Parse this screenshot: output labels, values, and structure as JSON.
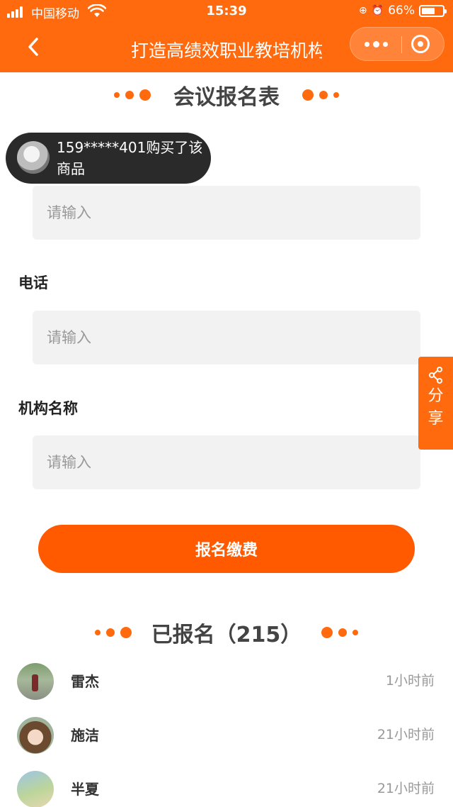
{
  "status_bar": {
    "carrier": "中国移动",
    "time": "15:39",
    "battery_text": "66%",
    "battery_level": 0.66
  },
  "nav": {
    "title": "打造高绩效职业教培机构",
    "back_icon": "chevron-left-icon",
    "more_icon": "more-dots-icon",
    "close_icon": "target-close-icon"
  },
  "form": {
    "title": "会议报名表",
    "toast": "159*****401购买了该商品",
    "fields": [
      {
        "label": "",
        "placeholder": "请输入"
      },
      {
        "label": "电话",
        "placeholder": "请输入"
      },
      {
        "label": "机构名称",
        "placeholder": "请输入"
      }
    ],
    "submit_label": "报名缴费"
  },
  "share": {
    "label": "分享",
    "icon": "share-icon"
  },
  "registrants": {
    "title": "已报名（215）",
    "items": [
      {
        "name": "雷杰",
        "time": "1小时前"
      },
      {
        "name": "施洁",
        "time": "21小时前"
      },
      {
        "name": "半夏",
        "time": "21小时前"
      }
    ]
  },
  "colors": {
    "brand": "#ff6a0f",
    "button": "#ff5a00",
    "toast_bg": "#2a2a2a",
    "input_bg": "#f2f2f2"
  }
}
